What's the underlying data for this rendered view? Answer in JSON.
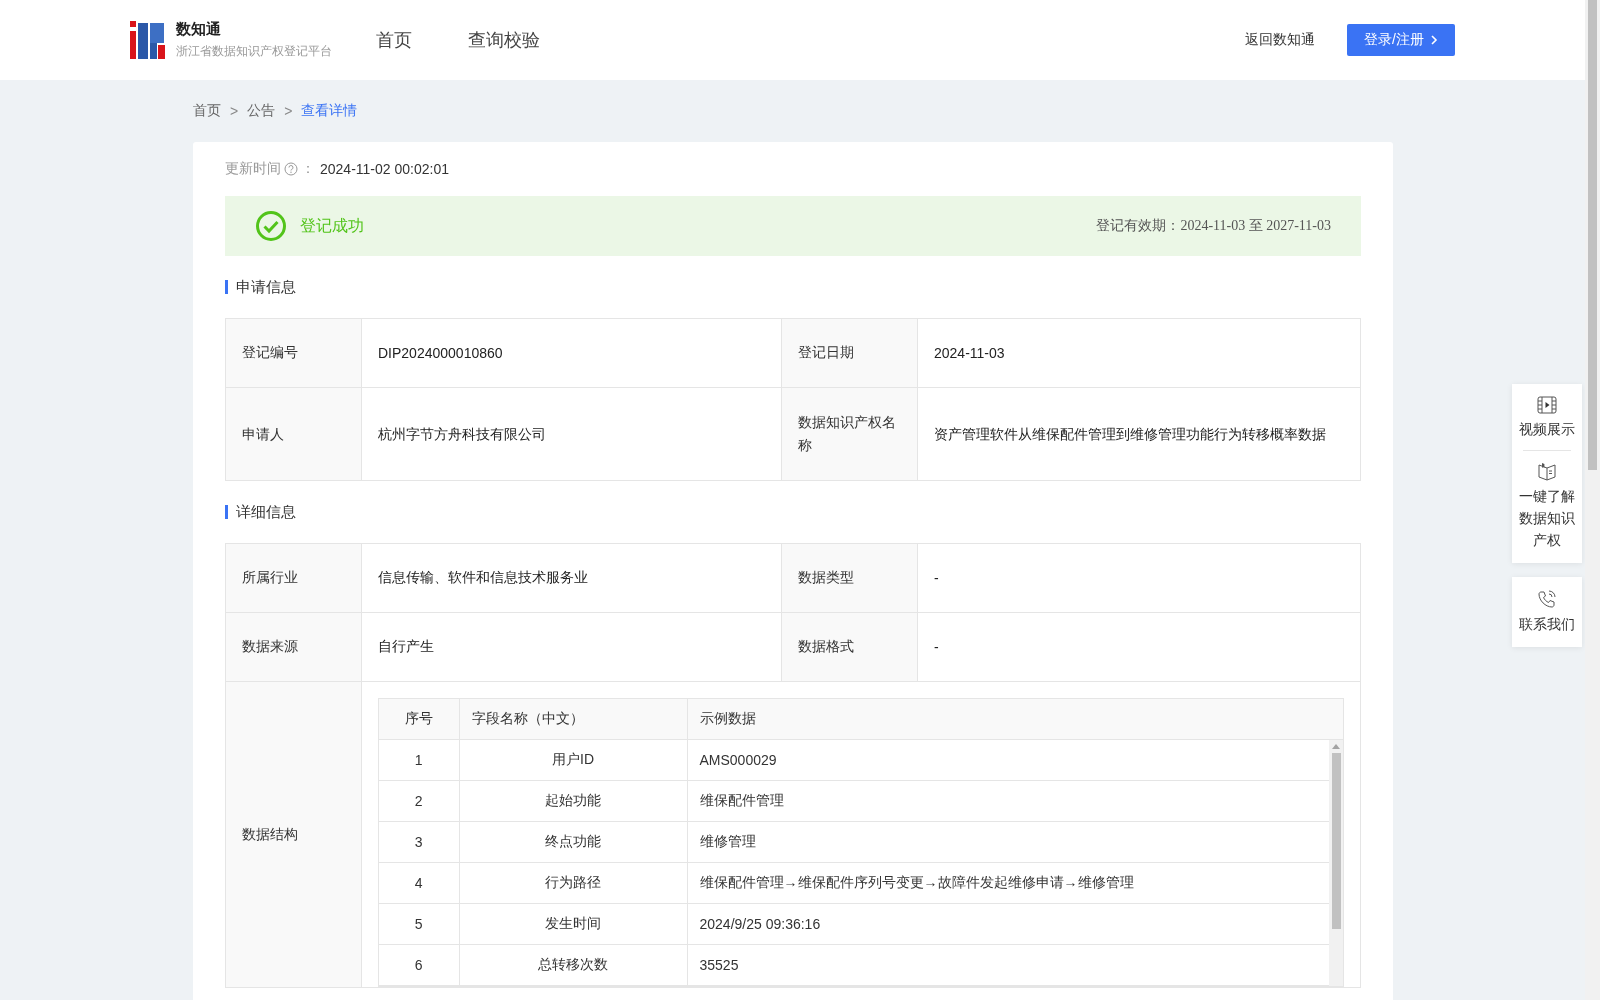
{
  "header": {
    "logo": {
      "title": "数知通",
      "subtitle": "浙江省数据知识产权登记平台"
    },
    "nav": [
      "首页",
      "查询校验"
    ],
    "back_link": "返回数知通",
    "login_button": "登录/注册"
  },
  "breadcrumb": [
    {
      "label": "首页",
      "selected": false
    },
    {
      "label": "公告",
      "selected": false
    },
    {
      "label": "查看详情",
      "selected": true
    }
  ],
  "breadcrumb_separator": ">",
  "update": {
    "label": "更新时间",
    "colon": "：",
    "value": "2024-11-02 00:02:01"
  },
  "status": {
    "success": true,
    "text": "登记成功",
    "validity_label": "登记有效期：",
    "validity_value": "2024-11-03 至 2027-11-03"
  },
  "apply_info": {
    "title": "申请信息",
    "rows": [
      {
        "cells": [
          "登记编号",
          "DIP2024000010860",
          "登记日期",
          "2024-11-03"
        ]
      },
      {
        "cells": [
          "申请人",
          "杭州字节方舟科技有限公司",
          "数据知识产权名称",
          "资产管理软件从维保配件管理到维修管理功能行为转移概率数据"
        ]
      }
    ]
  },
  "detail_info": {
    "title": "详细信息",
    "rows": [
      {
        "cells": [
          "所属行业",
          "信息传输、软件和信息技术服务业",
          "数据类型",
          "-"
        ]
      },
      {
        "cells": [
          "数据来源",
          "自行产生",
          "数据格式",
          "-"
        ]
      }
    ],
    "structure": {
      "label": "数据结构",
      "columns": [
        "序号",
        "字段名称（中文）",
        "示例数据"
      ],
      "rows": [
        [
          "1",
          "用户ID",
          "AMS000029"
        ],
        [
          "2",
          "起始功能",
          "维保配件管理"
        ],
        [
          "3",
          "终点功能",
          "维修管理"
        ],
        [
          "4",
          "行为路径",
          "维保配件管理→维保配件序列号变更→故障件发起维修申请→维修管理"
        ],
        [
          "5",
          "发生时间",
          "2024/9/25 09:36:16"
        ],
        [
          "6",
          "总转移次数",
          "35525"
        ]
      ]
    }
  },
  "side_panel": [
    [
      {
        "kind": "video",
        "label": "视频展示"
      },
      {
        "kind": "book",
        "label": "一键了解数据知识产权"
      }
    ],
    [
      {
        "kind": "phone",
        "label": "联系我们"
      }
    ]
  ]
}
